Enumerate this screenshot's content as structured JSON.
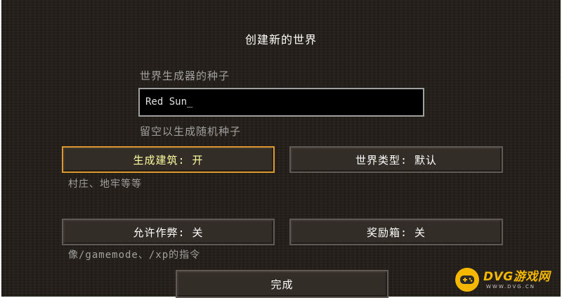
{
  "screen": {
    "title": "创建新的世界",
    "seed": {
      "label": "世界生成器的种子",
      "value": "Red Sun",
      "cursor": "_",
      "hint": "留空以生成随机种子"
    },
    "buttons": {
      "generate_structures": {
        "label": "生成建筑: 开",
        "hint": "村庄、地牢等等"
      },
      "world_type": {
        "label": "世界类型: 默认"
      },
      "allow_cheats": {
        "label": "允许作弊: 关",
        "hint": "像/gamemode、/xp的指令"
      },
      "bonus_chest": {
        "label": "奖励箱: 关"
      },
      "done": {
        "label": "完成"
      }
    }
  },
  "watermark": {
    "title": "DVG游戏网",
    "subtitle": "WWW.DVG.CN",
    "icon": "gamepad-icon",
    "color": "#f5b800"
  }
}
